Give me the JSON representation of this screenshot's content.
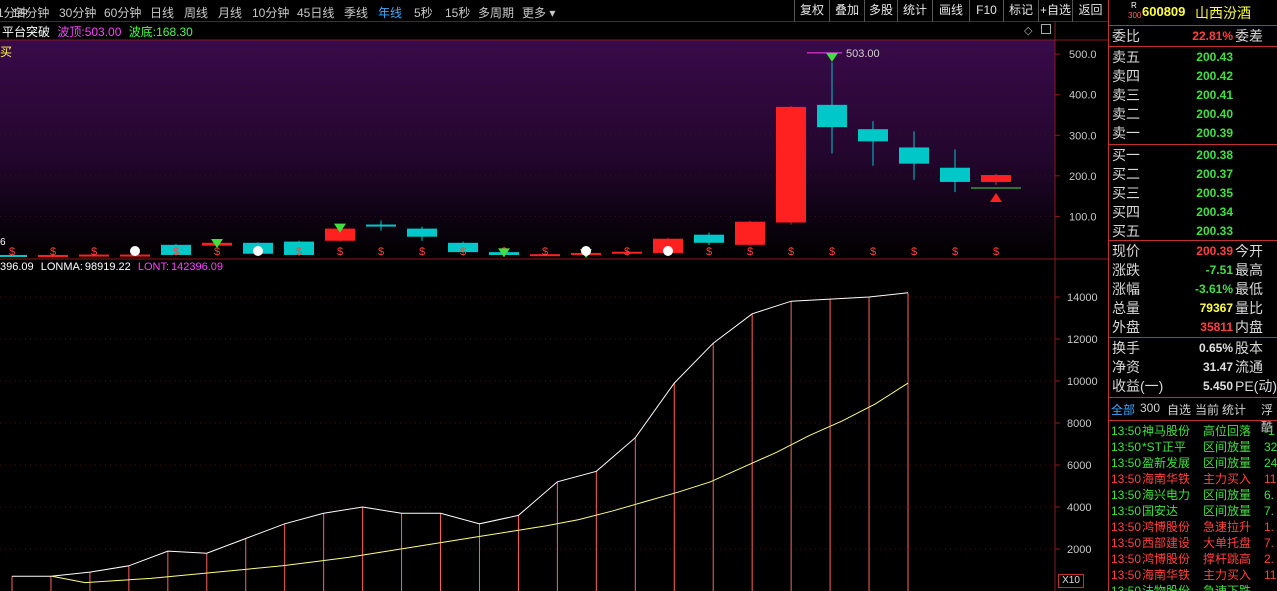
{
  "toolbar": {
    "timeframes": [
      "1分钟",
      "15分钟",
      "30分钟",
      "60分钟",
      "日线",
      "周线",
      "月线",
      "10分钟",
      "45日线",
      "季线",
      "年线",
      "5秒",
      "15秒",
      "多周期",
      "更多"
    ],
    "active": "年线",
    "tools": [
      "复权",
      "叠加",
      "多股",
      "统计",
      "画线",
      "F10",
      "标记",
      "+自选",
      "返回"
    ]
  },
  "indicators": {
    "main": {
      "name": "平台突破",
      "peak_label": "波顶:",
      "peak_value": "503.00",
      "trough_label": "波底:",
      "trough_value": "168.30"
    },
    "sub": {
      "a": "396.09",
      "lonma_label": "LONMA:",
      "lonma": "98919.22",
      "lont_label": "LONT:",
      "lont": "142396.09"
    },
    "x10": "X10",
    "peak_annot": "503.00",
    "left_edge_mark": "6",
    "left_edge_text": "买"
  },
  "chart_data": [
    {
      "type": "candlestick",
      "ylim": [
        0,
        520
      ],
      "yticks": [
        "100.0",
        "200.0",
        "300.0",
        "400.0",
        "500.0"
      ],
      "candles": [
        {
          "o": 5,
          "c": 3,
          "h": 6,
          "l": 2
        },
        {
          "o": 4,
          "c": 5,
          "h": 6,
          "l": 3
        },
        {
          "o": 5,
          "c": 6,
          "h": 7,
          "l": 4
        },
        {
          "o": 4,
          "c": 6,
          "h": 8,
          "l": 3
        },
        {
          "o": 30,
          "c": 5,
          "h": 32,
          "l": 4
        },
        {
          "o": 28,
          "c": 35,
          "h": 37,
          "l": 26
        },
        {
          "o": 35,
          "c": 8,
          "h": 36,
          "l": 6
        },
        {
          "o": 38,
          "c": 5,
          "h": 40,
          "l": 3
        },
        {
          "o": 40,
          "c": 70,
          "h": 75,
          "l": 38
        },
        {
          "o": 80,
          "c": 75,
          "h": 90,
          "l": 65
        },
        {
          "o": 70,
          "c": 50,
          "h": 75,
          "l": 40
        },
        {
          "o": 35,
          "c": 12,
          "h": 38,
          "l": 10
        },
        {
          "o": 12,
          "c": 5,
          "h": 14,
          "l": 3
        },
        {
          "o": 5,
          "c": 7,
          "h": 9,
          "l": 4
        },
        {
          "o": 8,
          "c": 10,
          "h": 12,
          "l": 6
        },
        {
          "o": 9,
          "c": 13,
          "h": 15,
          "l": 8
        },
        {
          "o": 10,
          "c": 45,
          "h": 47,
          "l": 9
        },
        {
          "o": 55,
          "c": 35,
          "h": 60,
          "l": 30
        },
        {
          "o": 30,
          "c": 87,
          "h": 89,
          "l": 28
        },
        {
          "o": 85,
          "c": 370,
          "h": 372,
          "l": 80
        },
        {
          "o": 375,
          "c": 320,
          "h": 480,
          "l": 255
        },
        {
          "o": 315,
          "c": 285,
          "h": 335,
          "l": 225
        },
        {
          "o": 270,
          "c": 230,
          "h": 310,
          "l": 190
        },
        {
          "o": 220,
          "c": 185,
          "h": 265,
          "l": 160
        },
        {
          "o": 185,
          "c": 202,
          "h": 205,
          "l": 178
        }
      ]
    },
    {
      "type": "line",
      "ylim": [
        0,
        15000
      ],
      "yticks": [
        "2000",
        "4000",
        "6000",
        "8000",
        "10000",
        "12000",
        "14000"
      ],
      "series": [
        {
          "name": "LONT",
          "values": [
            700,
            700,
            900,
            1200,
            1900,
            1800,
            2500,
            3200,
            3700,
            4000,
            3700,
            3700,
            3200,
            3600,
            5200,
            5700,
            7300,
            9900,
            11800,
            13200,
            13800,
            13900,
            14000,
            14200
          ]
        },
        {
          "name": "LONMA",
          "values": [
            700,
            400,
            500,
            600,
            750,
            900,
            1050,
            1200,
            1400,
            1600,
            1850,
            2100,
            2350,
            2600,
            2850,
            3100,
            3400,
            3800,
            4250,
            4700,
            5200,
            5900,
            6600,
            7400,
            8100,
            8900,
            9900
          ]
        }
      ]
    }
  ],
  "quote": {
    "code": "600809",
    "name": "山西汾酒",
    "badge_r": "R",
    "badge_300": "300",
    "weibi_label": "委比",
    "weibi": "22.81%",
    "weicha_label": "委差",
    "asks": [
      {
        "label": "卖五",
        "price": "200.43"
      },
      {
        "label": "卖四",
        "price": "200.42"
      },
      {
        "label": "卖三",
        "price": "200.41"
      },
      {
        "label": "卖二",
        "price": "200.40"
      },
      {
        "label": "卖一",
        "price": "200.39"
      }
    ],
    "bids": [
      {
        "label": "买一",
        "price": "200.38"
      },
      {
        "label": "买二",
        "price": "200.37"
      },
      {
        "label": "买三",
        "price": "200.35"
      },
      {
        "label": "买四",
        "price": "200.34"
      },
      {
        "label": "买五",
        "price": "200.33"
      }
    ],
    "stats": [
      {
        "label": "现价",
        "value": "200.39",
        "label2": "今开",
        "color": "#ff4040"
      },
      {
        "label": "涨跌",
        "value": "-7.51",
        "label2": "最高",
        "color": "#40e040"
      },
      {
        "label": "涨幅",
        "value": "-3.61%",
        "label2": "最低",
        "color": "#40e040"
      },
      {
        "label": "总量",
        "value": "79367",
        "label2": "量比",
        "color": "#ffff40"
      },
      {
        "label": "外盘",
        "value": "35811",
        "label2": "内盘",
        "color": "#ff4040"
      }
    ],
    "stats2": [
      {
        "label": "换手",
        "value": "0.65%",
        "label2": "股本"
      },
      {
        "label": "净资",
        "value": "31.47",
        "label2": "流通"
      },
      {
        "label": "收益(一)",
        "value": "5.450",
        "label2": "PE(动)"
      }
    ]
  },
  "events": {
    "tabs": [
      "全部",
      "300",
      "自选",
      "当前",
      "统计",
      "浮酷"
    ],
    "active": "全部",
    "rows": [
      {
        "time": "13:50",
        "stock": "神马股份",
        "event": "高位回落",
        "val": "-1",
        "color": "#40e040"
      },
      {
        "time": "13:50",
        "stock": "*ST正平",
        "event": "区间放量",
        "val": "32",
        "color": "#40e040"
      },
      {
        "time": "13:50",
        "stock": "盈新发展",
        "event": "区间放量",
        "val": "24",
        "color": "#40e040"
      },
      {
        "time": "13:50",
        "stock": "海南华铁",
        "event": "主力买入",
        "val": "11",
        "color": "#ff4040"
      },
      {
        "time": "13:50",
        "stock": "海兴电力",
        "event": "区间放量",
        "val": "6.",
        "color": "#40e040"
      },
      {
        "time": "13:50",
        "stock": "国安达",
        "event": "区间放量",
        "val": "7.",
        "color": "#40e040"
      },
      {
        "time": "13:50",
        "stock": "鸿博股份",
        "event": "急速拉升",
        "val": "1.",
        "color": "#ff4040"
      },
      {
        "time": "13:50",
        "stock": "西部建设",
        "event": "大单托盘",
        "val": "7.",
        "color": "#ff4040"
      },
      {
        "time": "13:50",
        "stock": "鸿博股份",
        "event": "撑杆跳高",
        "val": "2.",
        "color": "#ff4040"
      },
      {
        "time": "13:50",
        "stock": "海南华铁",
        "event": "主力买入",
        "val": "11",
        "color": "#ff4040"
      },
      {
        "time": "13:50",
        "stock": "法物股份",
        "event": "急速下跌",
        "val": "",
        "color": "#40e040"
      }
    ]
  },
  "colors": {
    "up": "#ff2020",
    "down": "#00c8c8",
    "grid": "#8b1a1a",
    "white": "#ffffff",
    "yellow": "#ffff80"
  }
}
